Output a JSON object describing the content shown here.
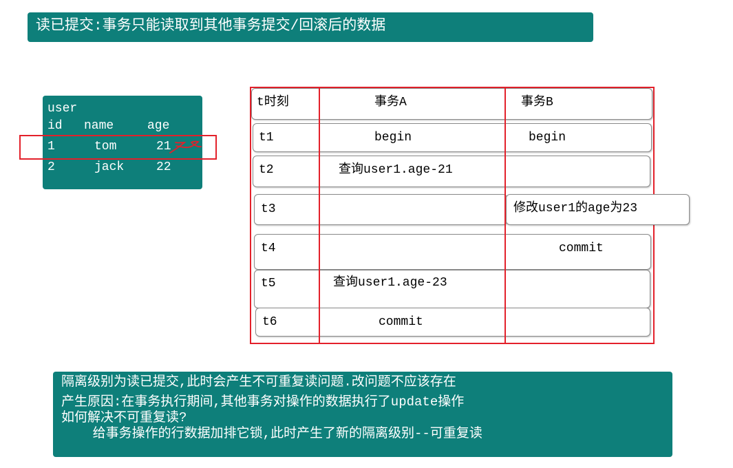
{
  "title": "读已提交:事务只能读取到其他事务提交/回滚后的数据",
  "user_table": {
    "name": "user",
    "headers": [
      "id",
      "name",
      "age"
    ],
    "rows": [
      {
        "id": "1",
        "name": "tom",
        "age": "21"
      },
      {
        "id": "2",
        "name": "jack",
        "age": "22"
      }
    ],
    "highlight_color": "#e3202a"
  },
  "timeline": {
    "headers": {
      "time": "t时刻",
      "a": "事务A",
      "b": "事务B"
    },
    "rows": [
      {
        "time": "t1",
        "a": "begin",
        "b": "begin"
      },
      {
        "time": "t2",
        "a": "查询user1.age-21",
        "b": ""
      },
      {
        "time": "t3",
        "a": "",
        "b": "修改user1的age为23"
      },
      {
        "time": "t4",
        "a": "",
        "b": "commit"
      },
      {
        "time": "t5",
        "a": "查询user1.age-23",
        "b": ""
      },
      {
        "time": "t6",
        "a": "commit",
        "b": ""
      }
    ]
  },
  "notes": {
    "line1": "隔离级别为读已提交,此时会产生不可重复读问题.改问题不应该存在",
    "line2": "产生原因:在事务执行期间,其他事务对操作的数据执行了update操作",
    "line3": "如何解决不可重复读?",
    "line4": "    给事务操作的行数据加排它锁,此时产生了新的隔离级别--可重复读"
  },
  "colors": {
    "teal": "#0e7f7a",
    "red": "#e3202a"
  }
}
